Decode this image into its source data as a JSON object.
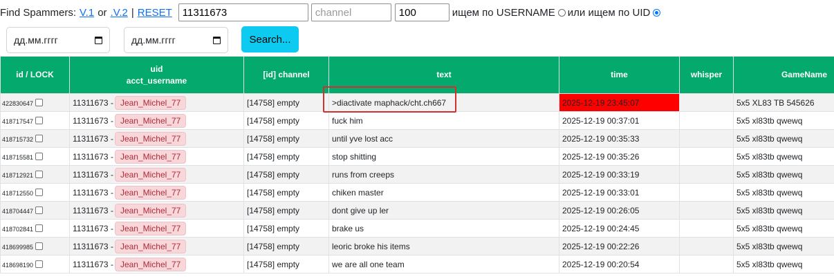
{
  "topbar": {
    "title": "Find Spammers:",
    "v1_link": "V.1",
    "or_text": "or",
    "v2_link": ".V.2",
    "pipe": "|",
    "reset_link": "RESET",
    "uid_value": "11311673",
    "channel_placeholder": "channel",
    "limit_value": "100",
    "search_by_username_label": "ищем по USERNAME",
    "search_by_uid_label": "или ищем по UID",
    "selected_mode": "uid"
  },
  "filters": {
    "date_from_placeholder": "дд.мм.гггг",
    "date_to_placeholder": "дд.мм.гггг",
    "search_button": "Search..."
  },
  "colors": {
    "header_bg": "#04aa6d",
    "search_button": "#0dcaf0",
    "highlight_time": "#ff0000",
    "username_badge": "#f8d7da",
    "annotation_box": "#d32f2f"
  },
  "table": {
    "headers": {
      "id": "id / LOCK",
      "uid_line1": "uid",
      "uid_line2": "acct_username",
      "channel": "[id] channel",
      "text": "text",
      "time": "time",
      "whisper": "whisper",
      "game": "GameName"
    },
    "rows": [
      {
        "id": "422830647",
        "uid": "11311673 -",
        "username": "Jean_Michel_77",
        "channel": "[14758] empty",
        "text": ">diactivate maphack/cht.ch667",
        "time": "2025-12-19 23:45:07",
        "whisper": "",
        "game": "5x5 XL83 TB 545626"
      },
      {
        "id": "418717547",
        "uid": "11311673 -",
        "username": "Jean_Michel_77",
        "channel": "[14758] empty",
        "text": "fuck him",
        "time": "2025-12-19 00:37:01",
        "whisper": "",
        "game": "5x5 xl83tb qwewq"
      },
      {
        "id": "418715732",
        "uid": "11311673 -",
        "username": "Jean_Michel_77",
        "channel": "[14758] empty",
        "text": "until yve lost acc",
        "time": "2025-12-19 00:35:33",
        "whisper": "",
        "game": "5x5 xl83tb qwewq"
      },
      {
        "id": "418715581",
        "uid": "11311673 -",
        "username": "Jean_Michel_77",
        "channel": "[14758] empty",
        "text": "stop shitting",
        "time": "2025-12-19 00:35:26",
        "whisper": "",
        "game": "5x5 xl83tb qwewq"
      },
      {
        "id": "418712921",
        "uid": "11311673 -",
        "username": "Jean_Michel_77",
        "channel": "[14758] empty",
        "text": "runs from creeps",
        "time": "2025-12-19 00:33:19",
        "whisper": "",
        "game": "5x5 xl83tb qwewq"
      },
      {
        "id": "418712550",
        "uid": "11311673 -",
        "username": "Jean_Michel_77",
        "channel": "[14758] empty",
        "text": "chiken master",
        "time": "2025-12-19 00:33:01",
        "whisper": "",
        "game": "5x5 xl83tb qwewq"
      },
      {
        "id": "418704447",
        "uid": "11311673 -",
        "username": "Jean_Michel_77",
        "channel": "[14758] empty",
        "text": "dont give up ler",
        "time": "2025-12-19 00:26:05",
        "whisper": "",
        "game": "5x5 xl83tb qwewq"
      },
      {
        "id": "418702841",
        "uid": "11311673 -",
        "username": "Jean_Michel_77",
        "channel": "[14758] empty",
        "text": "brake us",
        "time": "2025-12-19 00:24:45",
        "whisper": "",
        "game": "5x5 xl83tb qwewq"
      },
      {
        "id": "418699985",
        "uid": "11311673 -",
        "username": "Jean_Michel_77",
        "channel": "[14758] empty",
        "text": "leoric broke his items",
        "time": "2025-12-19 00:22:26",
        "whisper": "",
        "game": "5x5 xl83tb qwewq"
      },
      {
        "id": "418698190",
        "uid": "11311673 -",
        "username": "Jean_Michel_77",
        "channel": "[14758] empty",
        "text": "we are all one team",
        "time": "2025-12-19 00:20:54",
        "whisper": "",
        "game": "5x5 xl83tb qwewq"
      }
    ]
  }
}
